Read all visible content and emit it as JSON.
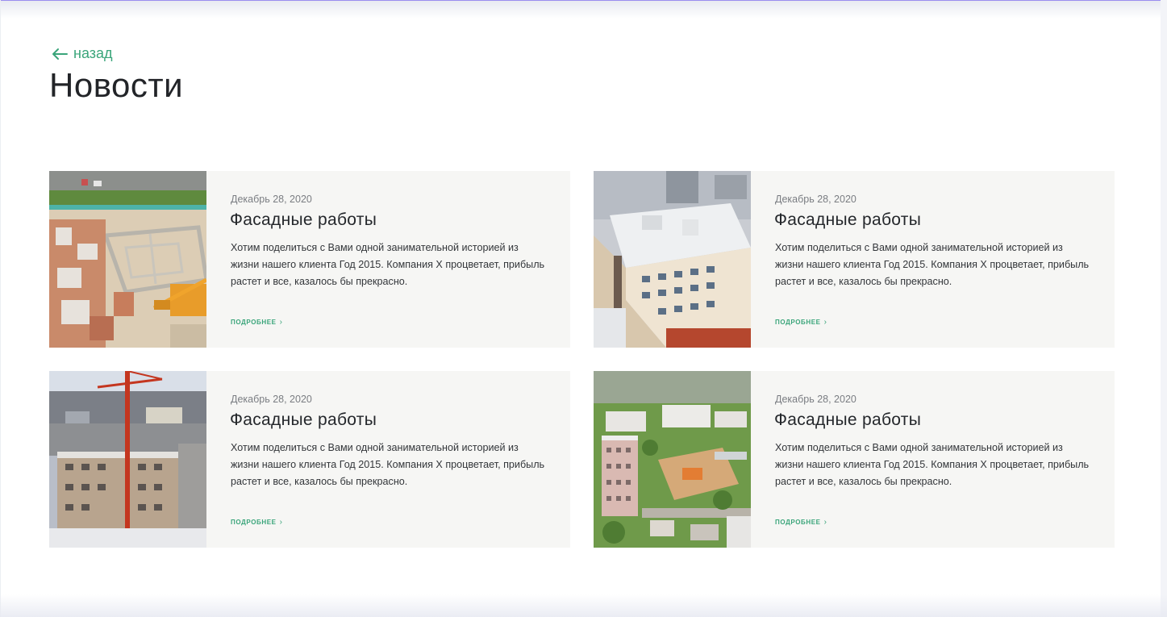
{
  "nav": {
    "back_label": "назад"
  },
  "page": {
    "title": "Новости"
  },
  "news": [
    {
      "date": "Декабрь 28, 2020",
      "title": "Фасадные работы",
      "text": "Хотим поделиться с Вами одной занимательной историей из жизни нашего клиента Год 2015. Компания X процветает, прибыль растет и все, казалось бы прекрасно.",
      "more": "ПОДРОБНЕЕ"
    },
    {
      "date": "Декабрь 28, 2020",
      "title": "Фасадные работы",
      "text": "Хотим поделиться с Вами одной занимательной историей из жизни нашего клиента Год 2015. Компания X процветает, прибыль растет и все, казалось бы прекрасно.",
      "more": "ПОДРОБНЕЕ"
    },
    {
      "date": "Декабрь 28, 2020",
      "title": "Фасадные работы",
      "text": "Хотим поделиться с Вами одной занимательной историей из жизни нашего клиента Год 2015. Компания X процветает, прибыль растет и все, казалось бы прекрасно.",
      "more": "ПОДРОБНЕЕ"
    },
    {
      "date": "Декабрь 28, 2020",
      "title": "Фасадные работы",
      "text": "Хотим поделиться с Вами одной занимательной историей из жизни нашего клиента Год 2015. Компания X процветает, прибыль растет и все, казалось бы прекрасно.",
      "more": "ПОДРОБНЕЕ"
    }
  ],
  "colors": {
    "accent": "#3aa57a",
    "card_bg": "#f6f6f4",
    "title": "#222428"
  }
}
